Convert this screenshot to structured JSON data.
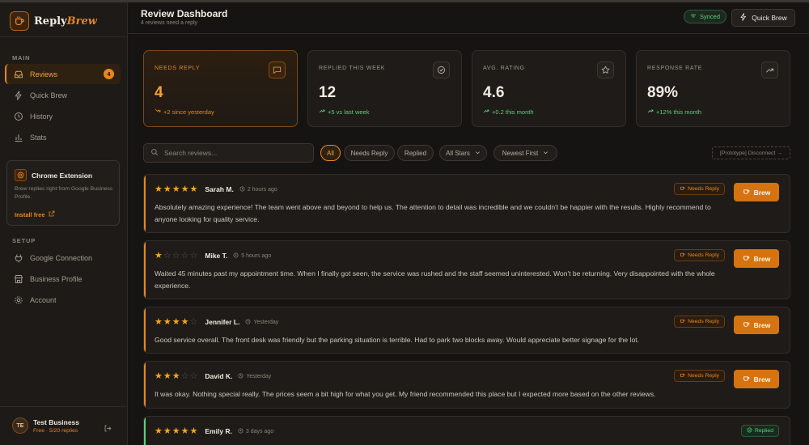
{
  "brand": {
    "name_part1": "Reply",
    "name_part2": "Brew"
  },
  "sidebar": {
    "main_label": "MAIN",
    "items": [
      {
        "label": "Reviews",
        "badge": "4",
        "icon": "inbox-icon"
      },
      {
        "label": "Quick Brew",
        "icon": "lightning-icon"
      },
      {
        "label": "History",
        "icon": "clock-icon"
      },
      {
        "label": "Stats",
        "icon": "bar-chart-icon"
      }
    ],
    "extension": {
      "title": "Chrome Extension",
      "desc": "Brew replies right from Google Business Profile.",
      "link": "Install free"
    },
    "setup_label": "SETUP",
    "setup_items": [
      {
        "label": "Google Connection",
        "icon": "plug-icon"
      },
      {
        "label": "Business Profile",
        "icon": "store-icon"
      },
      {
        "label": "Account",
        "icon": "gear-icon"
      }
    ],
    "user": {
      "initials": "TE",
      "name": "Test Business",
      "plan": "Free · 5/20 replies"
    }
  },
  "header": {
    "title": "Review Dashboard",
    "subtitle": "4 reviews need a reply",
    "synced": "Synced",
    "quick_brew": "Quick Brew"
  },
  "stats": [
    {
      "label": "NEEDS REPLY",
      "value": "4",
      "delta": "+2 since yesterday"
    },
    {
      "label": "REPLIED THIS WEEK",
      "value": "12",
      "delta": "+5 vs last week"
    },
    {
      "label": "AVG. RATING",
      "value": "4.6",
      "delta": "+0.2 this month"
    },
    {
      "label": "RESPONSE RATE",
      "value": "89%",
      "delta": "+12% this month"
    }
  ],
  "filters": {
    "search_placeholder": "Search reviews...",
    "pills": [
      "All",
      "Needs Reply",
      "Replied"
    ],
    "stars_select": "All Stars",
    "sort_select": "Newest First",
    "disconnect": "[Prototype] Disconnect →"
  },
  "colors": {
    "accent": "#e8871f",
    "success": "#5fd17d",
    "star": "#f5a524"
  },
  "reviews": [
    {
      "name": "Sarah M.",
      "rating": 5,
      "time": "2 hours ago",
      "status": "Needs Reply",
      "text": "Absolutely amazing experience! The team went above and beyond to help us. The attention to detail was incredible and we couldn't be happier with the results. Highly recommend to anyone looking for quality service.",
      "brew": "Brew"
    },
    {
      "name": "Mike T.",
      "rating": 1,
      "time": "5 hours ago",
      "status": "Needs Reply",
      "text": "Waited 45 minutes past my appointment time. When I finally got seen, the service was rushed and the staff seemed uninterested. Won't be returning. Very disappointed with the whole experience.",
      "brew": "Brew"
    },
    {
      "name": "Jennifer L.",
      "rating": 4,
      "time": "Yesterday",
      "status": "Needs Reply",
      "text": "Good service overall. The front desk was friendly but the parking situation is terrible. Had to park two blocks away. Would appreciate better signage for the lot.",
      "brew": "Brew"
    },
    {
      "name": "David K.",
      "rating": 3,
      "time": "Yesterday",
      "status": "Needs Reply",
      "text": "It was okay. Nothing special really. The prices seem a bit high for what you get. My friend recommended this place but I expected more based on the other reviews.",
      "brew": "Brew"
    },
    {
      "name": "Emily R.",
      "rating": 5,
      "time": "3 days ago",
      "status": "Replied"
    }
  ]
}
